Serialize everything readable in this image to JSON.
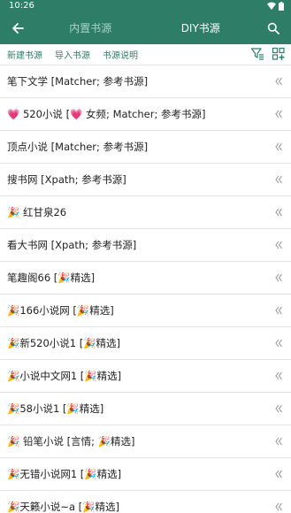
{
  "status_bar": {
    "time": "10:26"
  },
  "app_bar": {
    "tabs": [
      {
        "label": "内置书源",
        "active": false
      },
      {
        "label": "DIY书源",
        "active": true
      }
    ]
  },
  "toolbar": {
    "new_source": "新建书源",
    "import_source": "导入书源",
    "source_help": "书源说明"
  },
  "sources": [
    {
      "label": "笔下文学 [Matcher; 参考书源]"
    },
    {
      "label": "💗 520小说 [💗 女频; Matcher; 参考书源]"
    },
    {
      "label": "顶点小说 [Matcher; 参考书源]"
    },
    {
      "label": "搜书网 [Xpath; 参考书源]"
    },
    {
      "label": "🎉 红甘泉26"
    },
    {
      "label": "看大书网 [Xpath; 参考书源]"
    },
    {
      "label": "笔趣阁66 [🎉精选]"
    },
    {
      "label": "🎉166小说网 [🎉精选]"
    },
    {
      "label": "🎉新520小说1 [🎉精选]"
    },
    {
      "label": "🎉小说中文网1 [🎉精选]"
    },
    {
      "label": "🎉58小说1 [🎉精选]"
    },
    {
      "label": "🎉 铅笔小说 [言情; 🎉精选]"
    },
    {
      "label": "🎉无错小说网1 [🎉精选]"
    },
    {
      "label": "🎉天籁小说~a [🎉精选]"
    }
  ],
  "colors": {
    "primary": "#2e7d66",
    "tab_inactive": "#a8d5c6",
    "link": "#2e7d66"
  },
  "icons": {
    "back": "arrow-left-icon",
    "search": "search-icon",
    "filter": "filter-icon",
    "add_group": "add-group-icon",
    "row_action": "double-chevron-left-icon"
  }
}
